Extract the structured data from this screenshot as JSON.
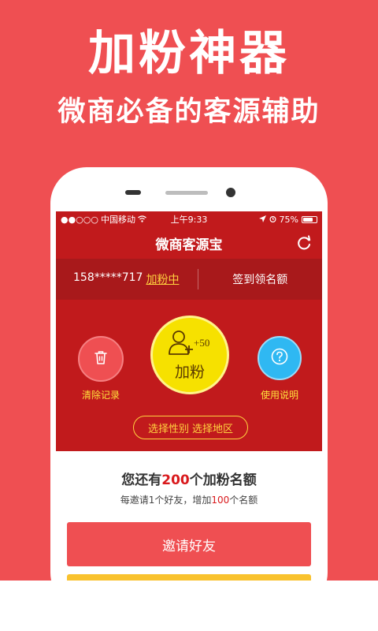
{
  "promo": {
    "title": "加粉神器",
    "subtitle": "微商必备的客源辅助"
  },
  "status_bar": {
    "signal": "●●○○○",
    "carrier": "中国移动",
    "time": "上午9:33",
    "battery": "75%",
    "battery_level": 0.75
  },
  "app": {
    "title": "微商客源宝"
  },
  "info": {
    "phone": "158*****717",
    "status_link": "加粉中",
    "signin": "签到领名额"
  },
  "actions": {
    "clear_label": "清除记录",
    "add_label": "加粉",
    "add_badge": "+50",
    "help_label": "使用说明",
    "select_gender": "选择性别",
    "select_region": "选择地区"
  },
  "quota": {
    "prefix": "您还有",
    "count": "200",
    "suffix": "个加粉名额",
    "sub_prefix": "每邀请1个好友，增加",
    "sub_count": "100",
    "sub_suffix": "个名额"
  },
  "invite": {
    "label": "邀请好友"
  },
  "colors": {
    "brand_red": "#c11a1c",
    "promo_red": "#ef4f52",
    "accent_yellow": "#f6e100",
    "help_blue": "#2fb8f2"
  }
}
